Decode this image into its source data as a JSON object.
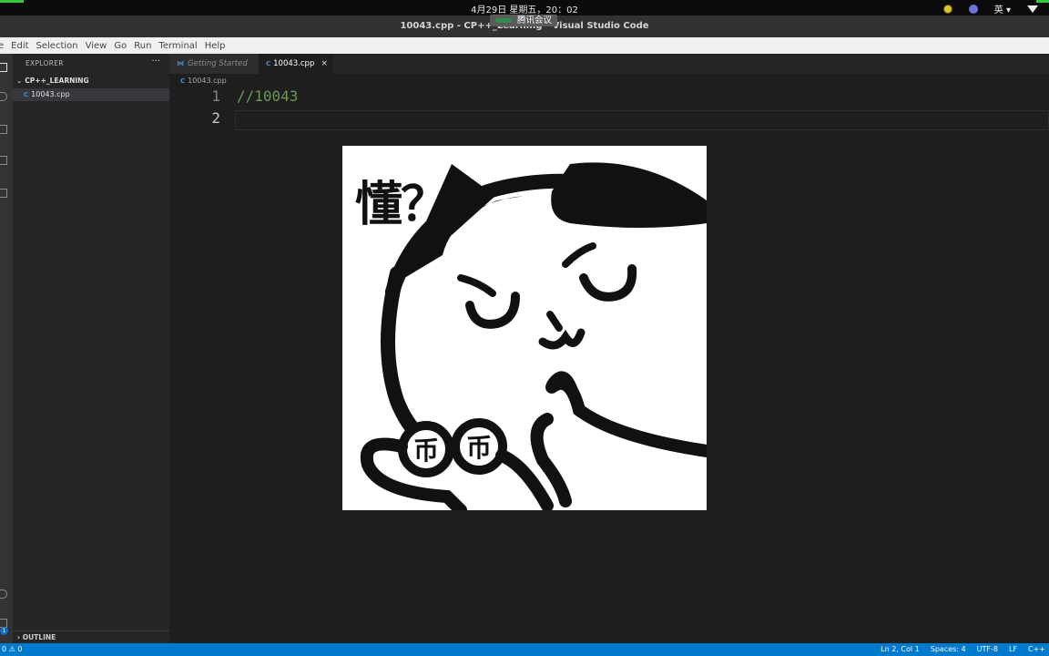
{
  "topbar": {
    "datetime": "4月29日 星期五，20：02",
    "ime": "英 ▾"
  },
  "meeting": {
    "label": "腾讯会议"
  },
  "window": {
    "title": "10043.cpp - CP++_Learning - Visual Studio Code"
  },
  "menu": [
    "e",
    "Edit",
    "Selection",
    "View",
    "Go",
    "Run",
    "Terminal",
    "Help"
  ],
  "sidebar": {
    "title": "EXPLORER",
    "more": "···",
    "folder": "CP++_LEARNING",
    "files": [
      {
        "name": "10043.cpp",
        "icon": "C"
      }
    ],
    "outline": "OUTLINE"
  },
  "tabs": [
    {
      "label": "Getting Started",
      "active": false
    },
    {
      "label": "10043.cpp",
      "active": true,
      "close": "×"
    }
  ],
  "breadcrumb": "10043.cpp",
  "editor": {
    "line_numbers": [
      "1",
      "2"
    ],
    "lines": [
      "//10043",
      ""
    ]
  },
  "meme": {
    "caption": "懂？"
  },
  "activity_badge": "1",
  "statusbar": {
    "left": "0 ⚠ 0",
    "position": "Ln 2, Col 1",
    "spaces": "Spaces: 4",
    "encoding": "UTF-8",
    "eol": "LF",
    "language": "C++"
  }
}
